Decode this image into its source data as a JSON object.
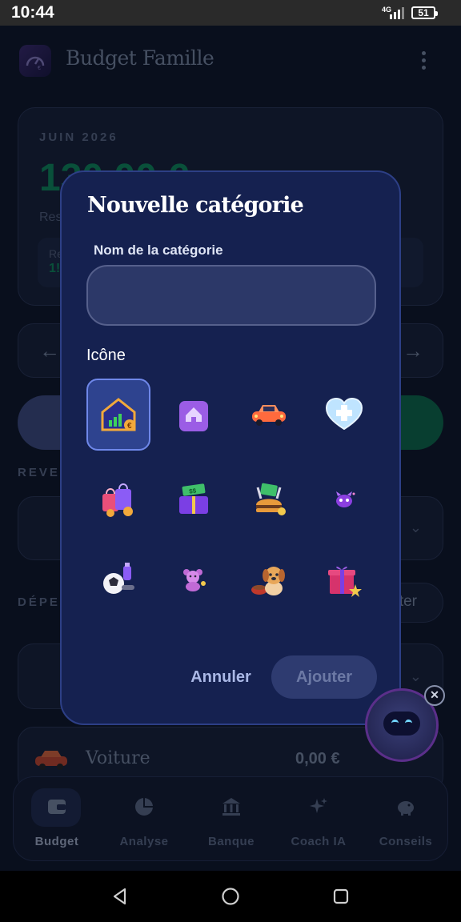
{
  "status_bar": {
    "time": "10:44",
    "network": "4G",
    "battery": "51"
  },
  "app": {
    "title": "Budget Famille",
    "summary": {
      "month": "JUIN 2026",
      "balance": "130,00 €",
      "sub_label": "Res",
      "left_box_label": "Re",
      "left_box_value": "1!"
    },
    "income_section_label": "REVEN",
    "expense_section_label": "DÉPEN",
    "expense_button_label": "ter",
    "expense_rows": [
      {
        "label": "Voiture",
        "amount": "0,00 €"
      }
    ],
    "bottom_nav": [
      {
        "label": "Budget",
        "icon": "wallet-icon",
        "active": true
      },
      {
        "label": "Analyse",
        "icon": "pie-chart-icon",
        "active": false
      },
      {
        "label": "Banque",
        "icon": "bank-icon",
        "active": false
      },
      {
        "label": "Coach IA",
        "icon": "sparkles-icon",
        "active": false
      },
      {
        "label": "Conseils",
        "icon": "piggy-bank-icon",
        "active": false
      }
    ]
  },
  "dialog": {
    "title": "Nouvelle catégorie",
    "name_field_label": "Nom de la catégorie",
    "name_field_value": "",
    "icon_section_label": "Icône",
    "icons": [
      {
        "name": "house-growth-icon",
        "selected": true
      },
      {
        "name": "home-document-icon",
        "selected": false
      },
      {
        "name": "car-icon",
        "selected": false
      },
      {
        "name": "health-heart-icon",
        "selected": false
      },
      {
        "name": "shopping-bags-icon",
        "selected": false
      },
      {
        "name": "gift-money-icon",
        "selected": false
      },
      {
        "name": "food-burger-icon",
        "selected": false
      },
      {
        "name": "sparkle-creature-icon",
        "selected": false
      },
      {
        "name": "sports-ball-icon",
        "selected": false
      },
      {
        "name": "teddy-bear-icon",
        "selected": false
      },
      {
        "name": "pet-dog-icon",
        "selected": false
      },
      {
        "name": "gift-box-icon",
        "selected": false
      }
    ],
    "cancel_label": "Annuler",
    "add_label": "Ajouter"
  },
  "colors": {
    "app_background": "#0e1526",
    "dialog_background": "#152150",
    "accent_green": "#0e8a5a",
    "selected_icon_background": "#2e438f"
  }
}
